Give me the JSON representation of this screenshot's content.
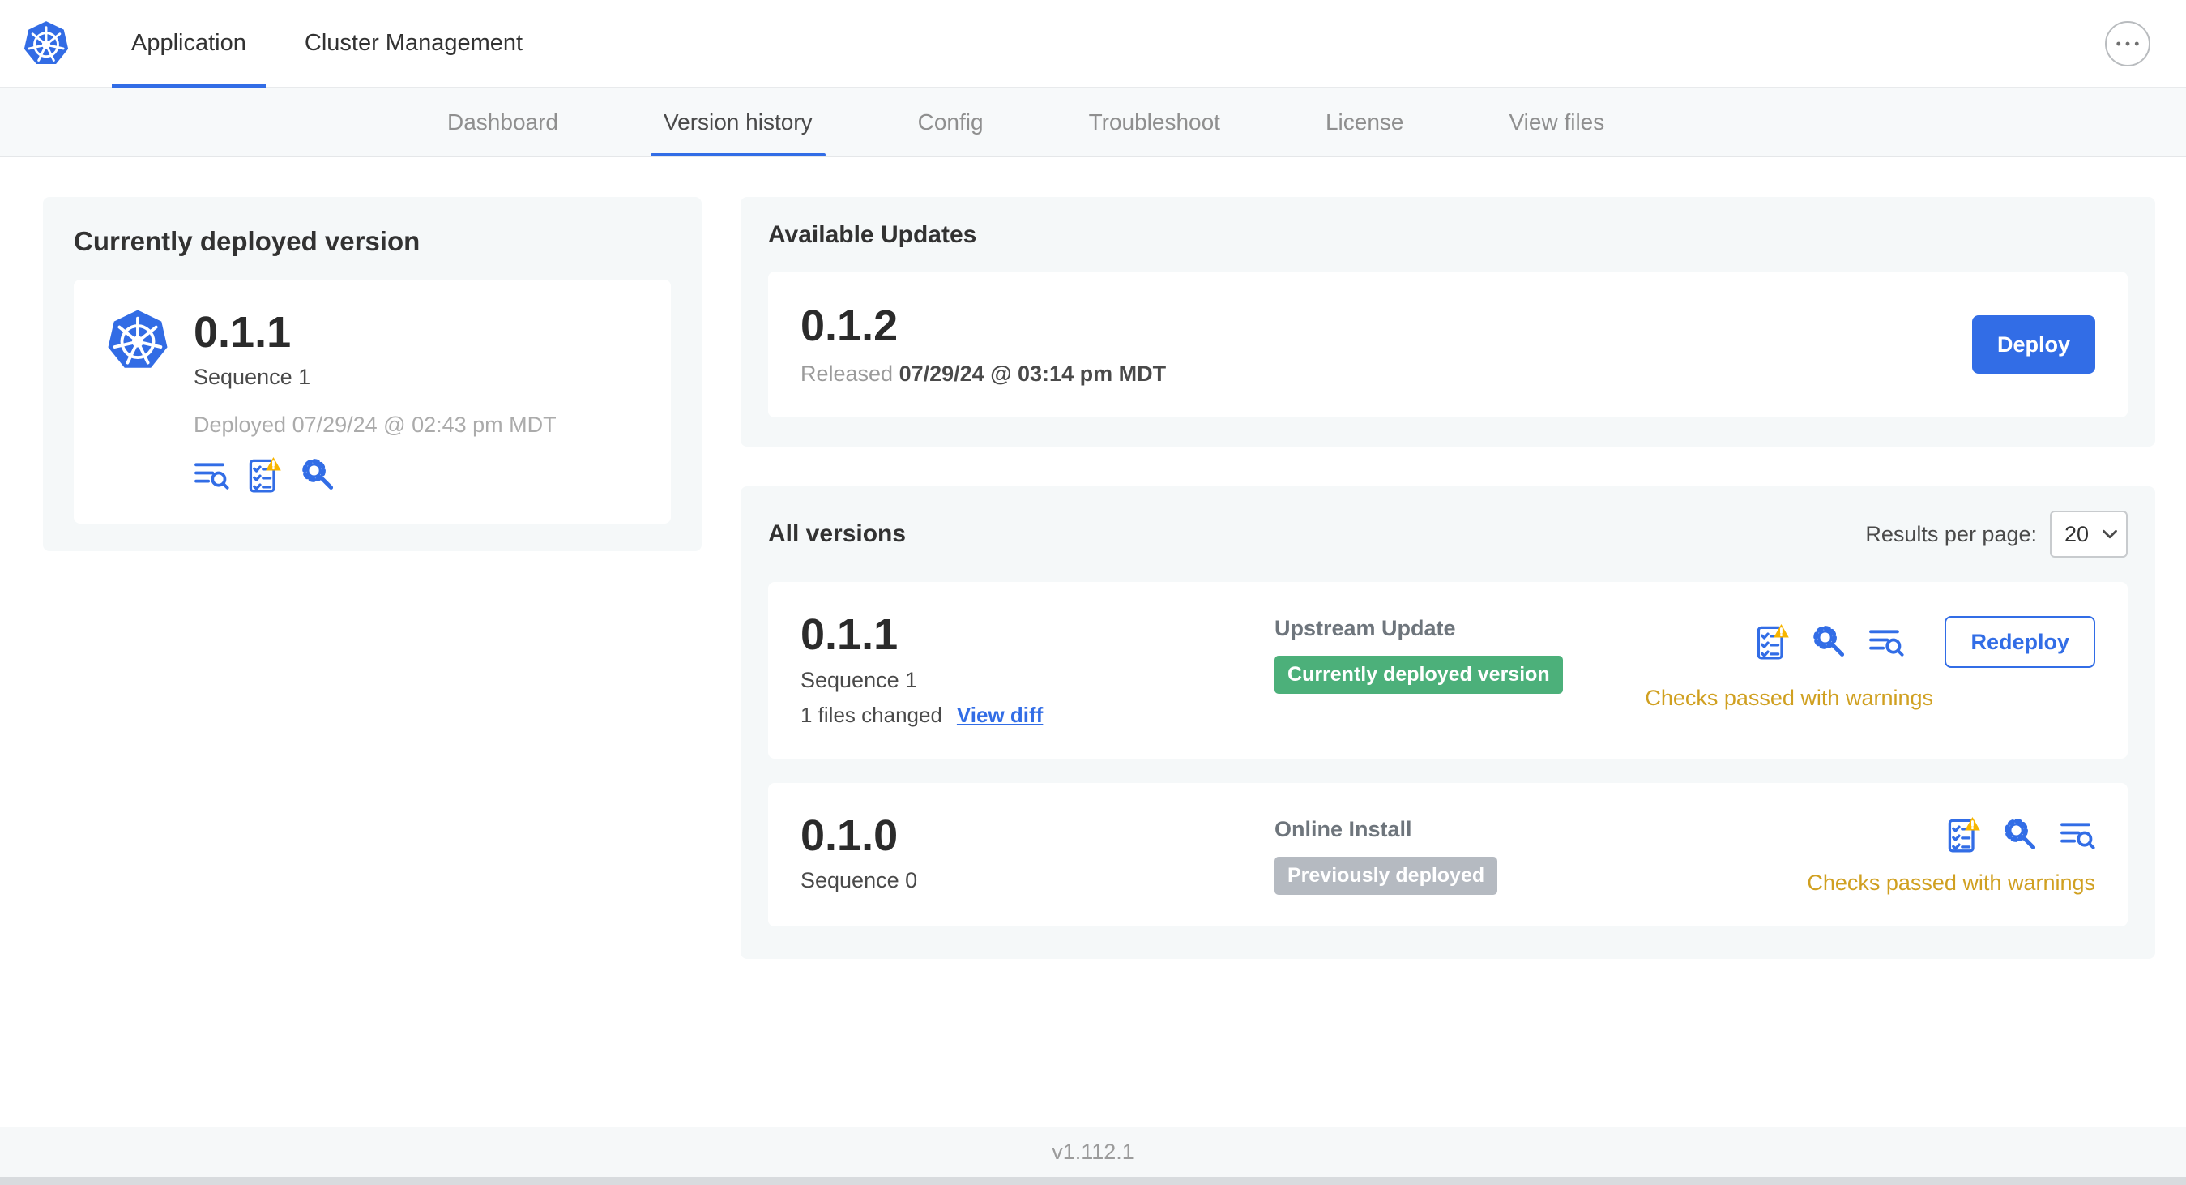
{
  "colors": {
    "accent_blue": "#326de6",
    "k8s_blue": "#326ce5",
    "success_green": "#4cb07a",
    "muted_badge": "#b5bac1",
    "warning_gold": "#d0a021"
  },
  "icons": {
    "brand": "kubernetes-logo",
    "menu": "ellipsis-icon",
    "logs": "logs-icon",
    "preflight": "preflight-checklist-warning-icon",
    "config": "config-tools-icon",
    "chevron": "chevron-down-icon"
  },
  "header": {
    "tabs": [
      {
        "label": "Application"
      },
      {
        "label": "Cluster Management"
      }
    ]
  },
  "subnav": {
    "tabs": [
      {
        "label": "Dashboard"
      },
      {
        "label": "Version history"
      },
      {
        "label": "Config"
      },
      {
        "label": "Troubleshoot"
      },
      {
        "label": "License"
      },
      {
        "label": "View files"
      }
    ]
  },
  "current": {
    "title": "Currently deployed version",
    "version": "0.1.1",
    "sequence": "Sequence 1",
    "deployed": "Deployed 07/29/24 @ 02:43 pm MDT"
  },
  "available": {
    "title": "Available Updates",
    "version": "0.1.2",
    "released_label": "Released",
    "released_date": "07/29/24 @ 03:14 pm MDT",
    "deploy_label": "Deploy"
  },
  "all_versions": {
    "title": "All versions",
    "results_per_page": {
      "label": "Results per page:",
      "value": "20"
    },
    "rows": [
      {
        "version": "0.1.1",
        "sequence": "Sequence 1",
        "files_changed": "1 files changed",
        "diff_link": "View diff",
        "source": "Upstream Update",
        "badge": "Currently deployed version",
        "status": "Checks passed with warnings",
        "action": "Redeploy"
      },
      {
        "version": "0.1.0",
        "sequence": "Sequence 0",
        "source": "Online Install",
        "badge": "Previously deployed",
        "status": "Checks passed with warnings"
      }
    ]
  },
  "footer": {
    "version": "v1.112.1"
  }
}
